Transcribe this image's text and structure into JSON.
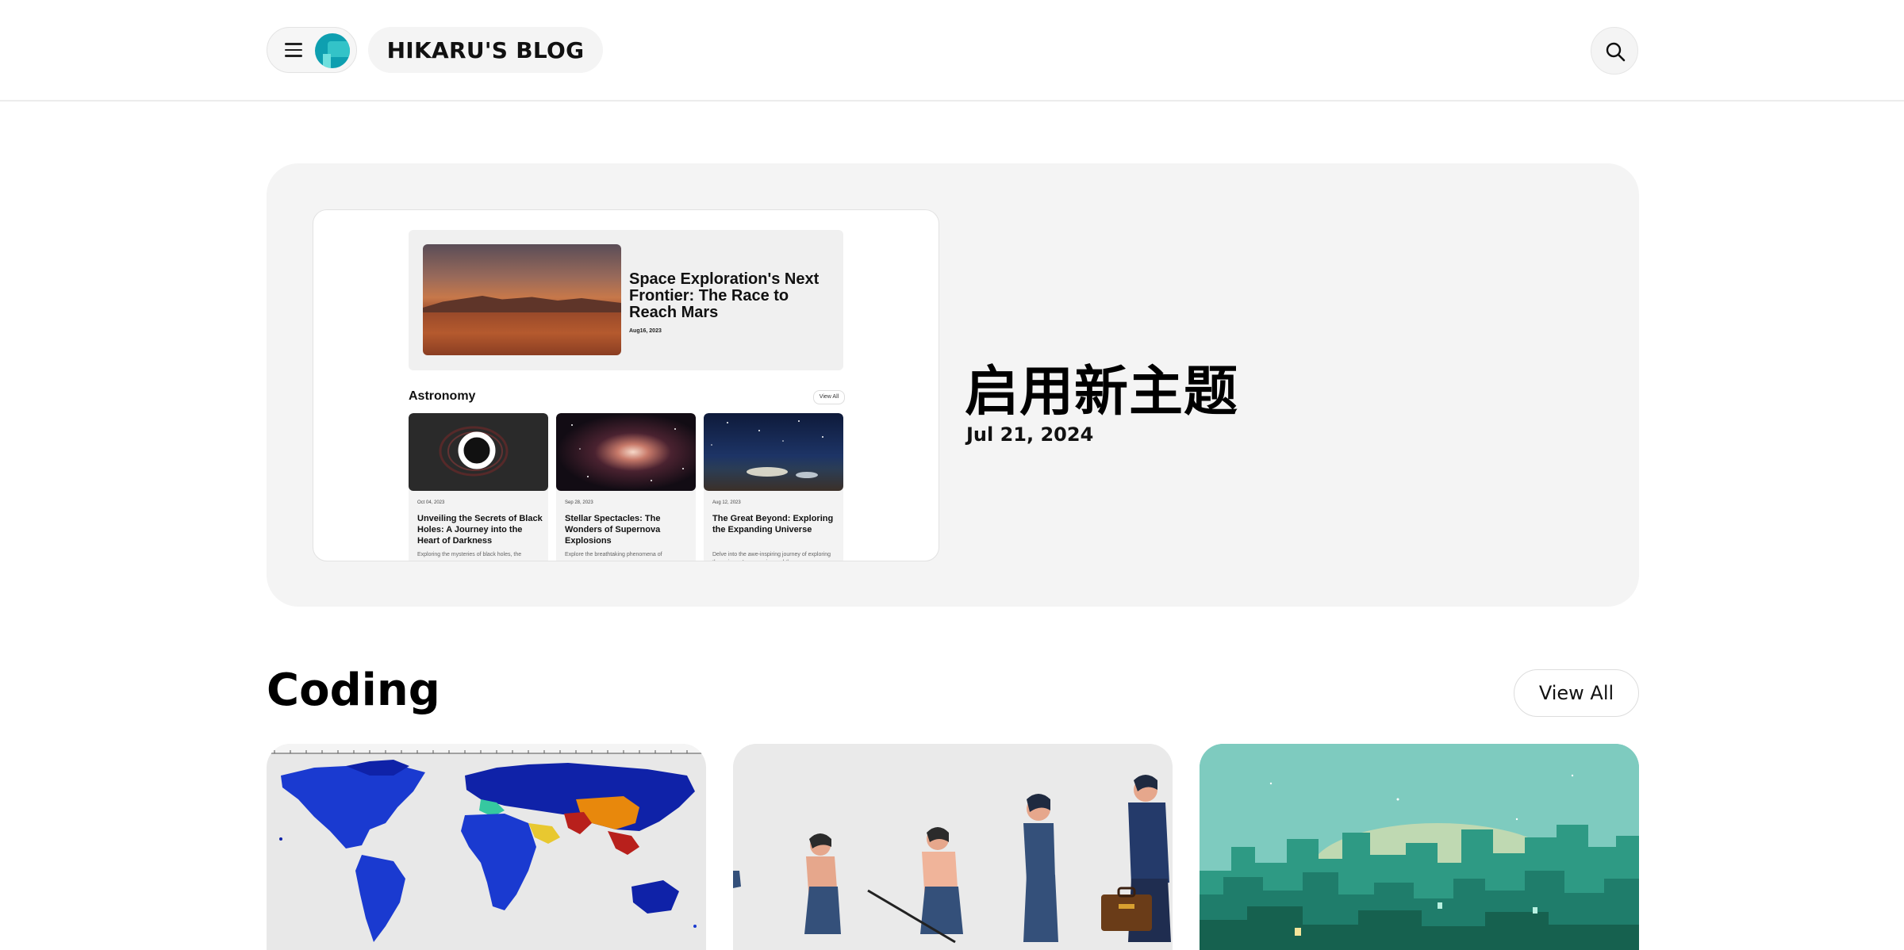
{
  "header": {
    "menu_icon": "hamburger-menu-icon",
    "logo_icon": "site-logo",
    "blog_title": "HIKARU'S BLOG",
    "search_icon": "search-icon"
  },
  "hero": {
    "title": "启用新主题",
    "date": "Jul 21, 2024",
    "preview": {
      "feature_title": "Space Exploration's Next Frontier: The Race to Reach Mars",
      "feature_date": "Aug16, 2023",
      "section_label": "Astronomy",
      "view_all": "View All",
      "cards": [
        {
          "date": "Oct 04, 2023",
          "title": "Unveiling the Secrets of Black Holes: A Journey into the Heart of Darkness",
          "desc": "Exploring the mysteries of black holes, the"
        },
        {
          "date": "Sep 28, 2023",
          "title": "Stellar Spectacles: The Wonders of Supernova Explosions",
          "desc": "Explore the breathtaking phenomena of"
        },
        {
          "date": "Aug 12, 2023",
          "title": "The Great Beyond: Exploring the Expanding Universe",
          "desc": "Delve into the awe-inspiring journey of exploring the universe's expansion and the..."
        }
      ]
    }
  },
  "section": {
    "title": "Coding",
    "view_all": "View All",
    "cards": [
      {
        "image": "world-map-image"
      },
      {
        "image": "human-evolution-image"
      },
      {
        "image": "teal-city-image"
      }
    ]
  },
  "colors": {
    "logo": "#0e9fb0",
    "hero_bg": "#f4f4f4",
    "city_bg": "#7ecbbf"
  }
}
